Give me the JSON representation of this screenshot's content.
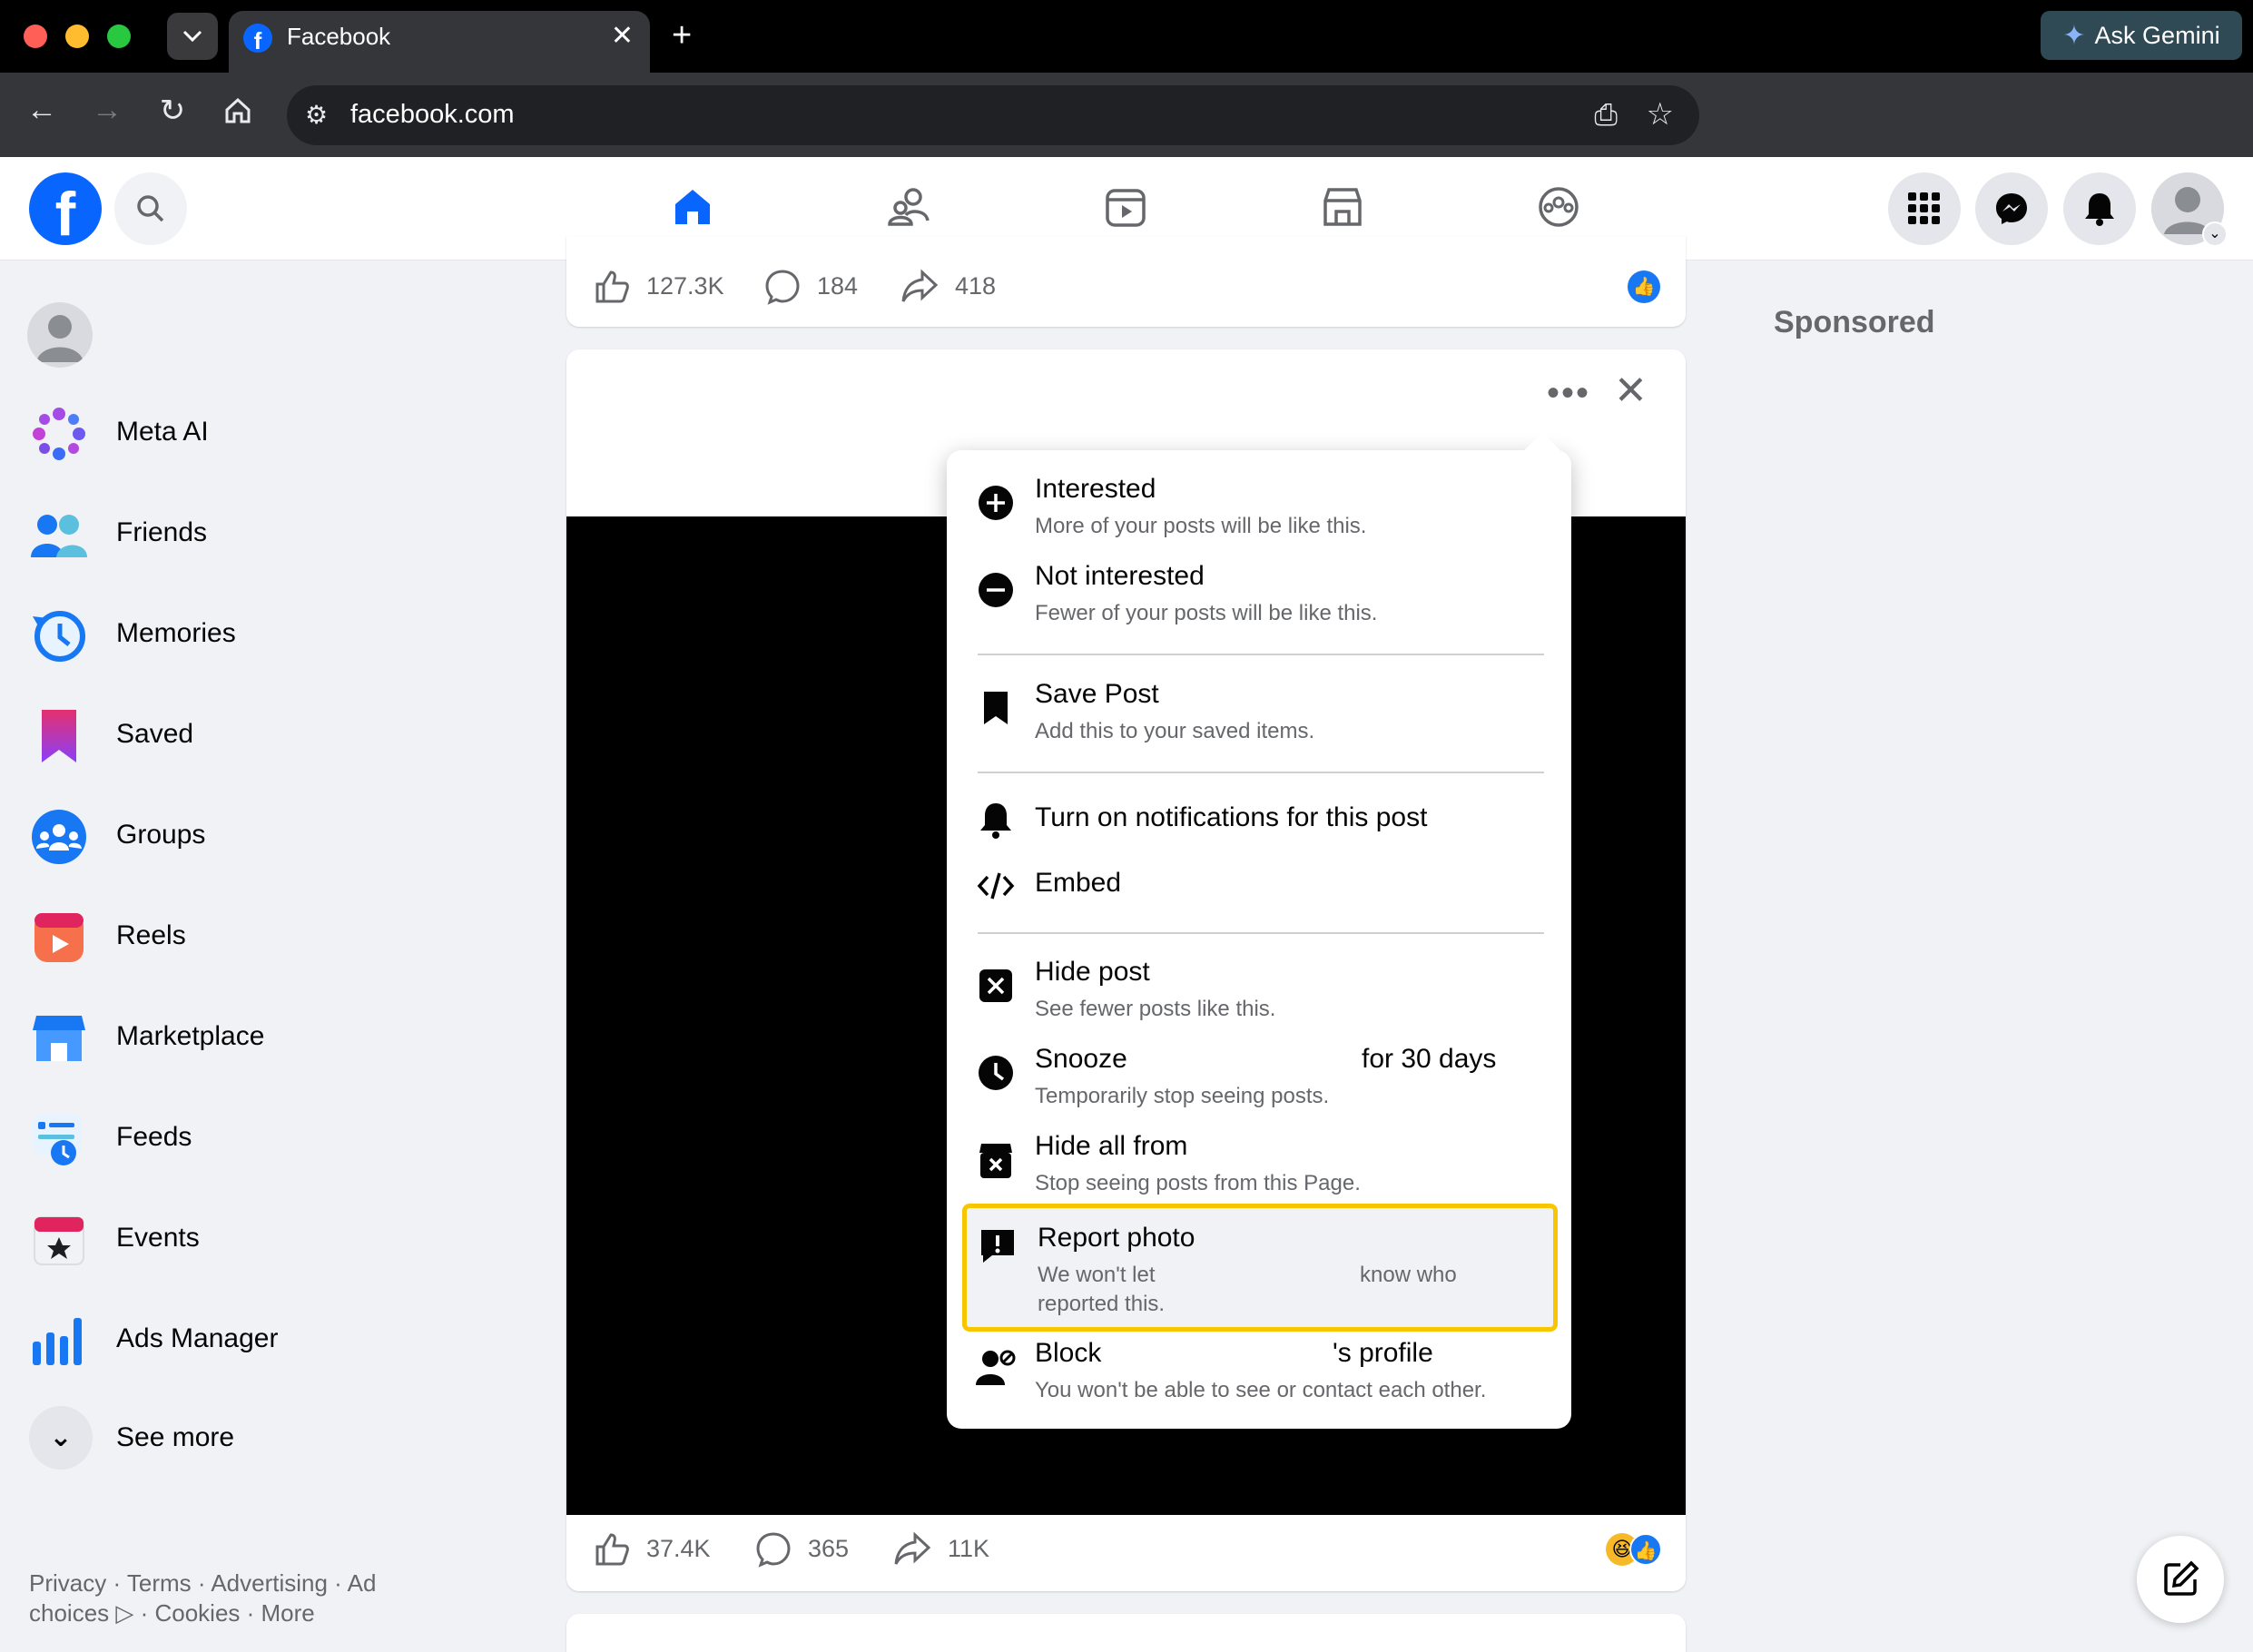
{
  "browser": {
    "tab_title": "Facebook",
    "url": "facebook.com",
    "gemini_label": "Ask Gemini"
  },
  "sidebar": {
    "items": [
      {
        "label": "Meta AI",
        "icon": "meta-ai-icon"
      },
      {
        "label": "Friends",
        "icon": "friends-icon"
      },
      {
        "label": "Memories",
        "icon": "memories-icon"
      },
      {
        "label": "Saved",
        "icon": "saved-icon"
      },
      {
        "label": "Groups",
        "icon": "groups-icon"
      },
      {
        "label": "Reels",
        "icon": "reels-icon"
      },
      {
        "label": "Marketplace",
        "icon": "marketplace-icon"
      },
      {
        "label": "Feeds",
        "icon": "feeds-icon"
      },
      {
        "label": "Events",
        "icon": "events-icon"
      },
      {
        "label": "Ads Manager",
        "icon": "ads-manager-icon"
      }
    ],
    "see_more": "See more",
    "footer": "Privacy · Terms · Advertising · Ad choices ▷ · Cookies · More"
  },
  "right": {
    "sponsored": "Sponsored"
  },
  "post1": {
    "likes": "127.3K",
    "comments": "184",
    "shares": "418"
  },
  "post2": {
    "likes": "37.4K",
    "comments": "365",
    "shares": "11K"
  },
  "menu": {
    "interested_title": "Interested",
    "interested_sub": "More of your posts will be like this.",
    "not_interested_title": "Not interested",
    "not_interested_sub": "Fewer of your posts will be like this.",
    "save_title": "Save Post",
    "save_sub": "Add this to your saved items.",
    "notify_title": "Turn on notifications for this post",
    "embed_title": "Embed",
    "hide_title": "Hide post",
    "hide_sub": "See fewer posts like this.",
    "snooze_title": "Snooze",
    "snooze_suffix": "for 30 days",
    "snooze_sub": "Temporarily stop seeing posts.",
    "hide_all_title": "Hide all from",
    "hide_all_sub": "Stop seeing posts from this Page.",
    "report_title": "Report photo",
    "report_sub1": "We won't let",
    "report_sub1b": "know who",
    "report_sub2": "reported this.",
    "block_title": "Block",
    "block_suffix": "'s profile",
    "block_sub": "You won't be able to see or contact each other."
  },
  "colors": {
    "brand": "#0866ff",
    "highlight": "#f7c600"
  }
}
